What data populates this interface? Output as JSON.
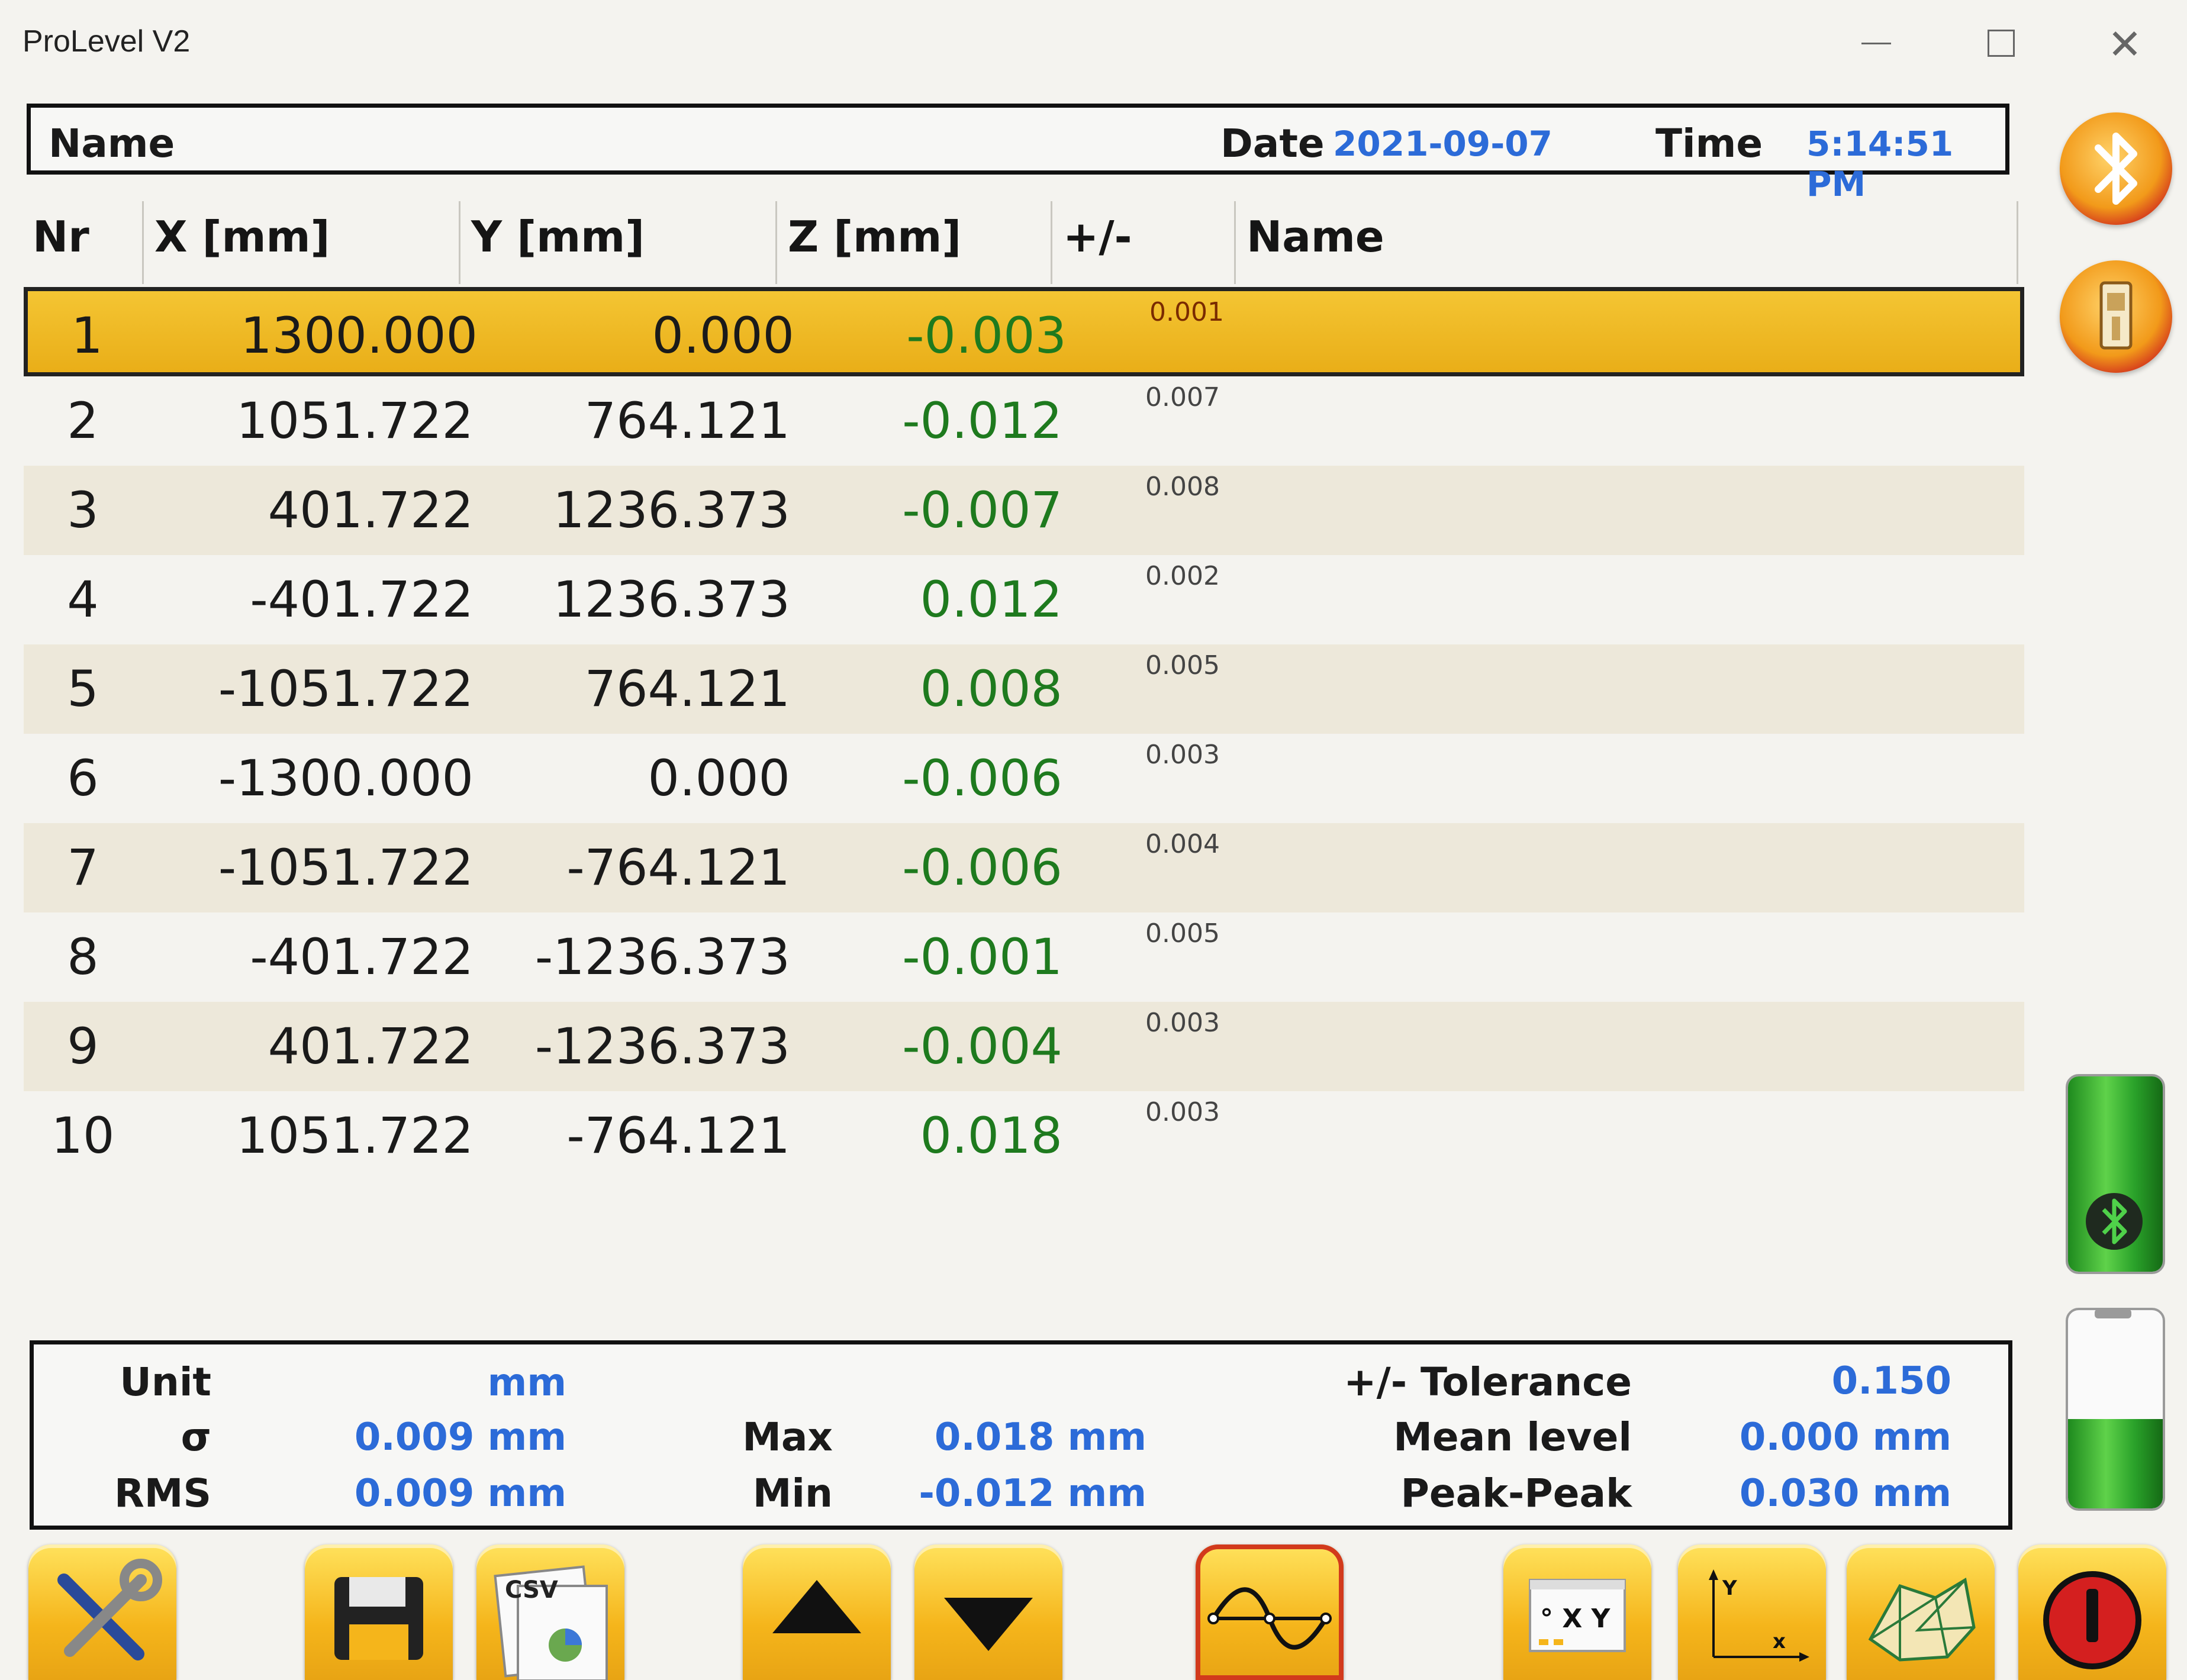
{
  "window": {
    "title": "ProLevel V2",
    "close_glyph": "✕"
  },
  "header": {
    "name_label": "Name",
    "date_label": "Date",
    "date_value": "2021-09-07",
    "time_label": "Time",
    "time_value": "5:14:51 PM"
  },
  "table": {
    "columns": [
      "Nr",
      "X [mm]",
      "Y [mm]",
      "Z [mm]",
      "+/-",
      "Name"
    ],
    "selected_row": 1,
    "rows": [
      {
        "nr": "1",
        "x": "1300.000",
        "y": "0.000",
        "z": "-0.003",
        "pm": "0.001"
      },
      {
        "nr": "2",
        "x": "1051.722",
        "y": "764.121",
        "z": "-0.012",
        "pm": "0.007"
      },
      {
        "nr": "3",
        "x": "401.722",
        "y": "1236.373",
        "z": "-0.007",
        "pm": "0.008"
      },
      {
        "nr": "4",
        "x": "-401.722",
        "y": "1236.373",
        "z": "0.012",
        "pm": "0.002"
      },
      {
        "nr": "5",
        "x": "-1051.722",
        "y": "764.121",
        "z": "0.008",
        "pm": "0.005"
      },
      {
        "nr": "6",
        "x": "-1300.000",
        "y": "0.000",
        "z": "-0.006",
        "pm": "0.003"
      },
      {
        "nr": "7",
        "x": "-1051.722",
        "y": "-764.121",
        "z": "-0.006",
        "pm": "0.004"
      },
      {
        "nr": "8",
        "x": "-401.722",
        "y": "-1236.373",
        "z": "-0.001",
        "pm": "0.005"
      },
      {
        "nr": "9",
        "x": "401.722",
        "y": "-1236.373",
        "z": "-0.004",
        "pm": "0.003"
      },
      {
        "nr": "10",
        "x": "1051.722",
        "y": "-764.121",
        "z": "0.018",
        "pm": "0.003"
      }
    ]
  },
  "stats": {
    "unit_label": "Unit",
    "unit_value": "mm",
    "sigma_label": "σ",
    "sigma_value": "0.009 mm",
    "rms_label": "RMS",
    "rms_value": "0.009 mm",
    "max_label": "Max",
    "max_value": "0.018 mm",
    "min_label": "Min",
    "min_value": "-0.012 mm",
    "tolerance_label": "+/- Tolerance",
    "tolerance_value": "0.150",
    "mean_label": "Mean level",
    "mean_value": "0.000 mm",
    "pp_label": "Peak-Peak",
    "pp_value": "0.030 mm"
  },
  "toolbar": {
    "csv_label": "CSV",
    "xy_label": "° X Y",
    "axis_y_label": "Y",
    "axis_x_label": "x"
  },
  "status": {
    "battery_device_level": 1.0,
    "battery_host_level": 0.45
  },
  "colors": {
    "accent_blue": "#2c6bd8",
    "z_green": "#1e7a1e",
    "selected_row": "#f0bb28",
    "alt_row": "#ede8da",
    "button_yellow": "#f5b51b",
    "power_red": "#d41f1f"
  }
}
